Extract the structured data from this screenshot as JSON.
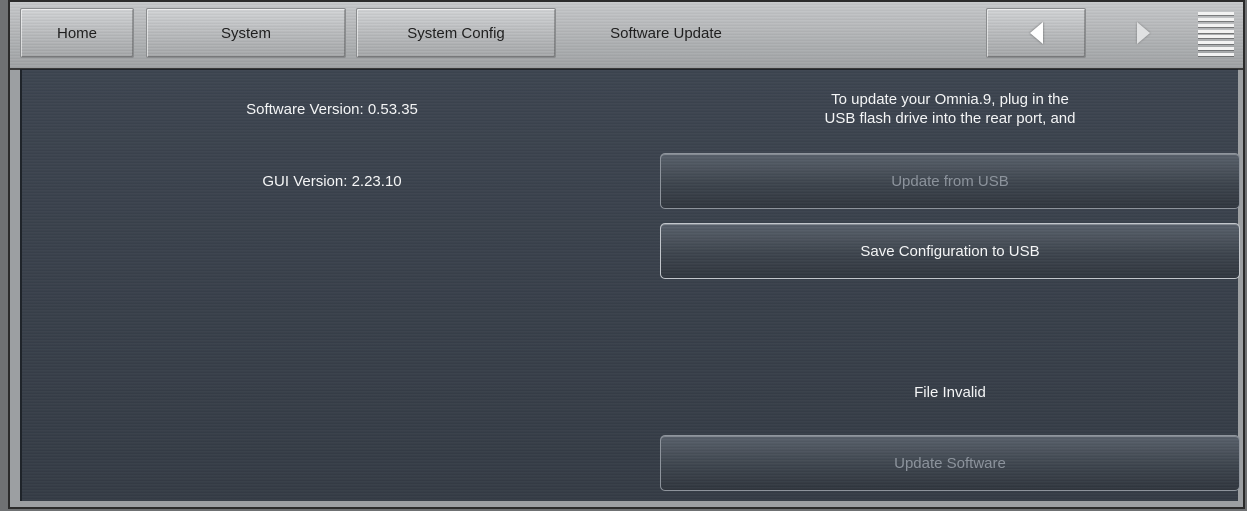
{
  "nav": {
    "home": "Home",
    "system": "System",
    "system_config": "System Config",
    "current_page": "Software Update",
    "back_icon": "chevron-left-icon",
    "forward_icon": "chevron-right-icon",
    "menu_icon": "menu-icon"
  },
  "info": {
    "software_version": "Software Version: 0.53.35",
    "gui_version": "GUI Version: 2.23.10",
    "instructions_line1": "To update your Omnia.9, plug in the",
    "instructions_line2": "USB flash drive into the rear port, and",
    "status": "File Invalid"
  },
  "buttons": {
    "update_from_usb": "Update from USB",
    "save_config": "Save Configuration to USB",
    "update_software": "Update Software"
  },
  "colors": {
    "panel_bg": "#3a414b",
    "text": "#f4f5f6",
    "disabled_text": "#8c939c"
  }
}
